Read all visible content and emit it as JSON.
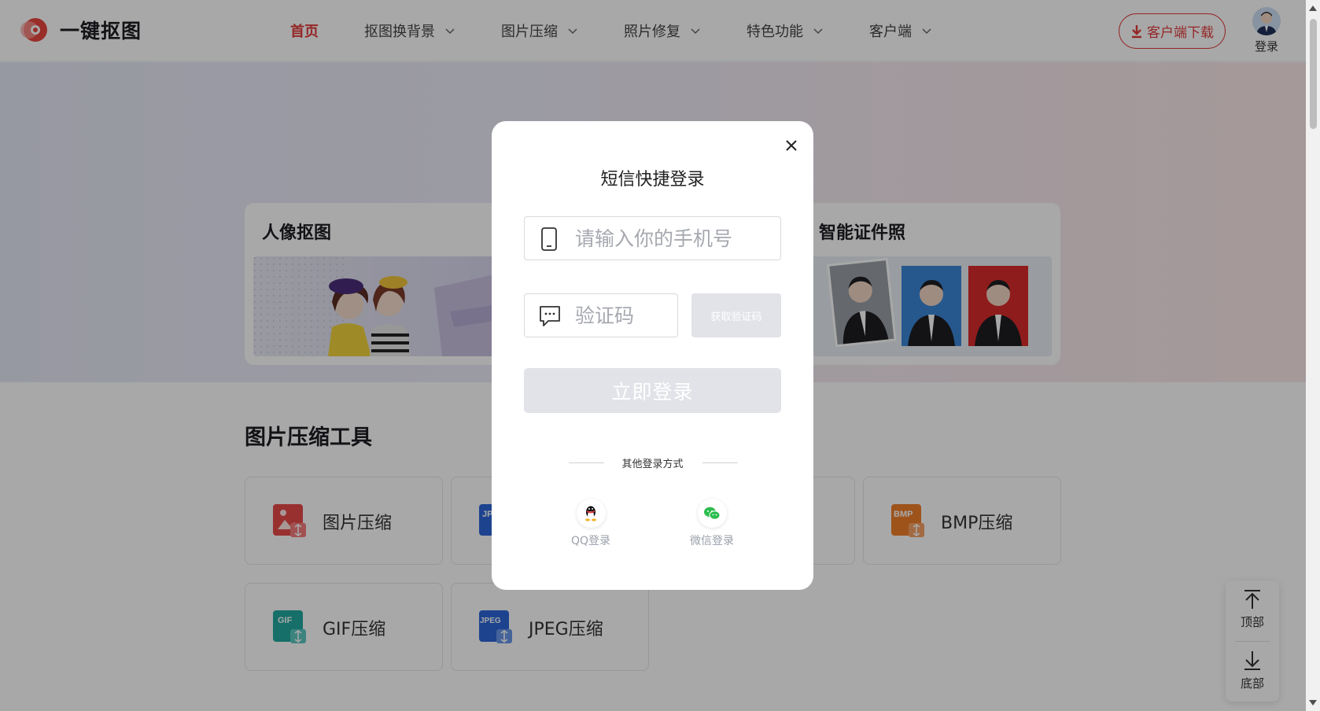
{
  "header": {
    "logo_text": "一键抠图",
    "nav": [
      {
        "label": "首页",
        "active": true,
        "has_dropdown": false
      },
      {
        "label": "抠图换背景",
        "active": false,
        "has_dropdown": true
      },
      {
        "label": "图片压缩",
        "active": false,
        "has_dropdown": true
      },
      {
        "label": "照片修复",
        "active": false,
        "has_dropdown": true
      },
      {
        "label": "特色功能",
        "active": false,
        "has_dropdown": true
      },
      {
        "label": "客户端",
        "active": false,
        "has_dropdown": true
      }
    ],
    "download_label": "客户端下载",
    "login_label": "登录"
  },
  "banner": {
    "cards": [
      {
        "title": "人像抠图"
      },
      {
        "title": "智能证件照"
      }
    ]
  },
  "section": {
    "title": "图片压缩工具",
    "tools": [
      {
        "label": "图片压缩",
        "icon": "image-compress-icon",
        "icon_text": ""
      },
      {
        "label": "",
        "icon": "jpg-compress-icon",
        "icon_text": "JP"
      },
      {
        "label": "",
        "icon": "png-compress-icon",
        "icon_text": ""
      },
      {
        "label": "BMP压缩",
        "icon": "bmp-compress-icon",
        "icon_text": "BMP"
      },
      {
        "label": "GIF压缩",
        "icon": "gif-compress-icon",
        "icon_text": "GIF"
      },
      {
        "label": "JPEG压缩",
        "icon": "jpeg-compress-icon",
        "icon_text": "JPEG"
      }
    ]
  },
  "float_bar": {
    "top_label": "顶部",
    "bottom_label": "底部"
  },
  "modal": {
    "title": "短信快捷登录",
    "phone_placeholder": "请输入你的手机号",
    "code_placeholder": "验证码",
    "get_code_label": "获取验证码",
    "submit_label": "立即登录",
    "other_methods_label": "其他登录方式",
    "qq_label": "QQ登录",
    "wechat_label": "微信登录"
  },
  "colors": {
    "accent": "#e23b3b",
    "disabled_button": "#e1e3e8",
    "overlay": "rgba(0,0,0,0.34)"
  }
}
